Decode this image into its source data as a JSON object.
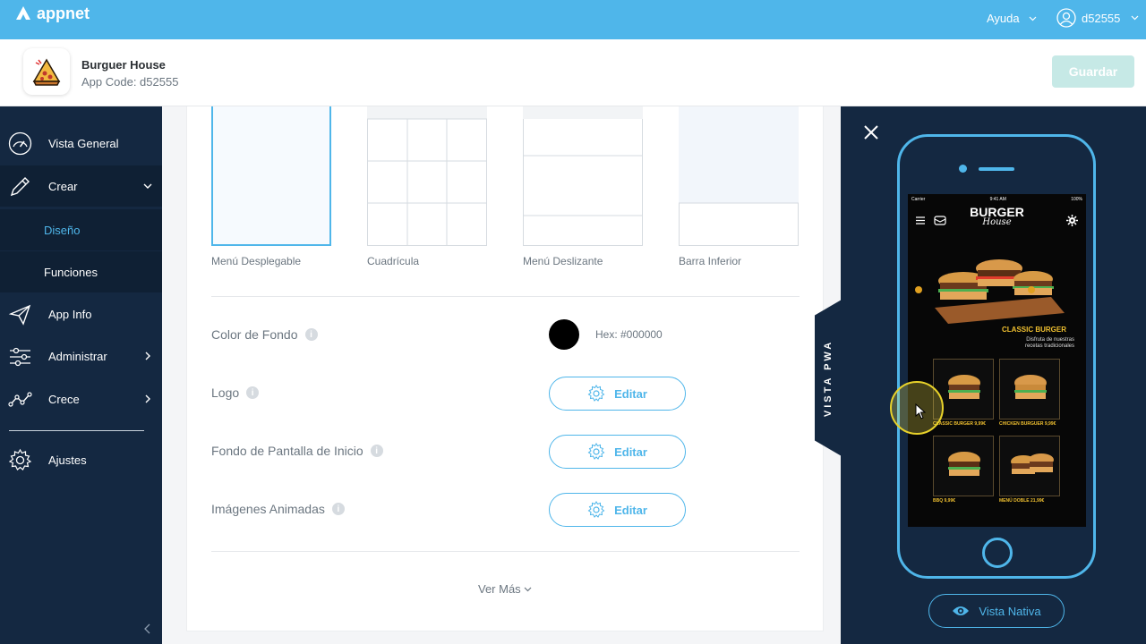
{
  "topbar": {
    "logo_text": "appnet",
    "help_label": "Ayuda",
    "user_label": "d52555"
  },
  "app": {
    "name": "Burguer House",
    "code": "App Code: d52555",
    "save_label": "Guardar"
  },
  "sidebar": {
    "items": [
      {
        "label": "Vista General",
        "icon": "dashboard-icon"
      },
      {
        "label": "Crear",
        "icon": "pencil-icon",
        "expanded": true
      },
      {
        "label": "App Info",
        "icon": "paper-plane-icon"
      },
      {
        "label": "Administrar",
        "icon": "sliders-icon"
      },
      {
        "label": "Crece",
        "icon": "growth-icon"
      },
      {
        "label": "Ajustes",
        "icon": "gear-icon"
      }
    ],
    "subitems": [
      {
        "label": "Diseño",
        "current": true
      },
      {
        "label": "Funciones",
        "current": false
      }
    ]
  },
  "layouts": [
    {
      "label": "Menú Desplegable",
      "selected": true
    },
    {
      "label": "Cuadrícula",
      "selected": false
    },
    {
      "label": "Menú Deslizante",
      "selected": false
    },
    {
      "label": "Barra Inferior",
      "selected": false
    }
  ],
  "settings": {
    "background_color_label": "Color de Fondo",
    "background_hex": "Hex: #000000",
    "background_color": "#000000",
    "logo_label": "Logo",
    "home_wallpaper_label": "Fondo de Pantalla de Inicio",
    "animated_images_label": "Imágenes Animadas",
    "edit_label": "Editar",
    "more_label": "Ver Más"
  },
  "preview": {
    "pwa_tab_label": "VISTA PWA",
    "native_button_label": "Vista Nativa",
    "screen": {
      "carrier": "Carrier",
      "time": "9:41 AM",
      "battery": "100%",
      "brand_top": "BURGER",
      "brand_bottom": "House",
      "hero_title": "CLASSIC BURGER",
      "hero_subtitle": "Disfruta de nuestras recetas tradicionales",
      "tiles": [
        {
          "caption": "CLASSIC BURGER 9,99€"
        },
        {
          "caption": "CHICKEN BURGUER 9,99€"
        },
        {
          "caption": "BBQ 9,99€"
        },
        {
          "caption": "MENÚ DOBLE 21,99€"
        }
      ]
    }
  },
  "colors": {
    "accent": "#4fb6ea",
    "sidebar": "#142841",
    "save_disabled": "#c6e9e6"
  }
}
